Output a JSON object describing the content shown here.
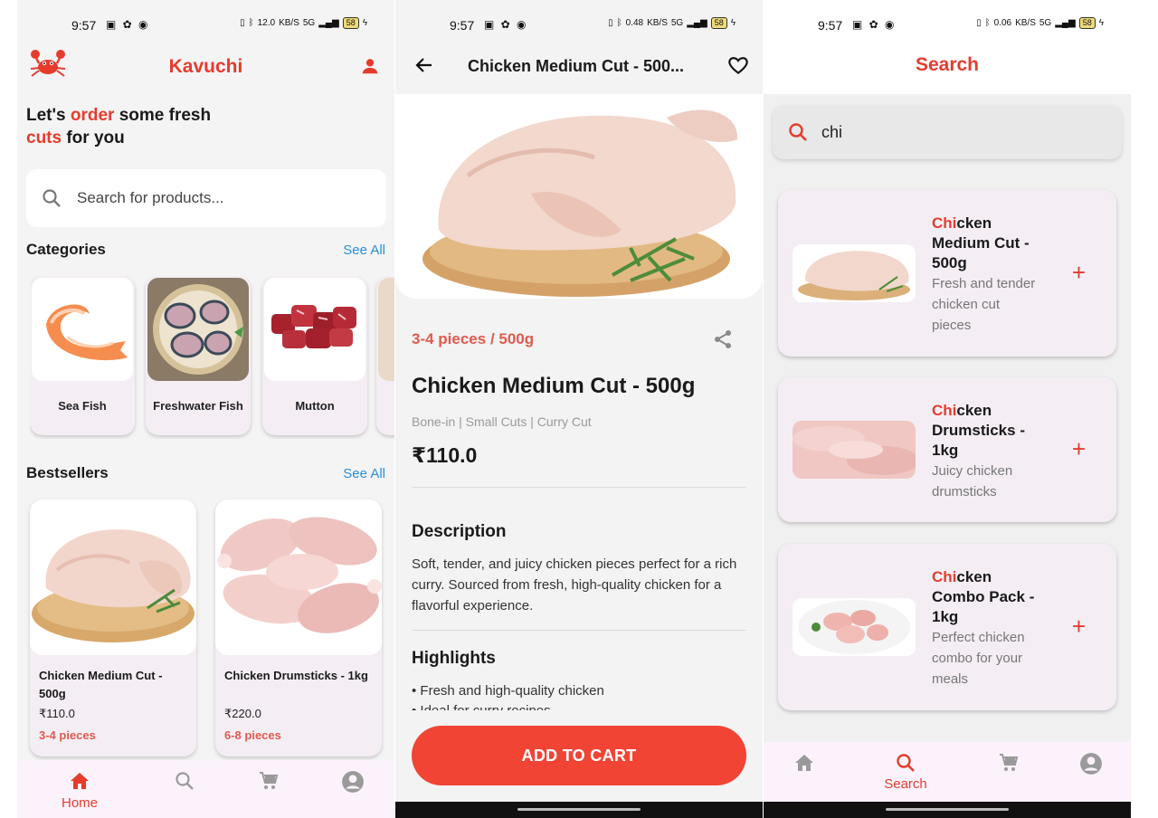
{
  "status": {
    "time": "9:57",
    "speeds": [
      "12.0",
      "0.48",
      "0.06"
    ],
    "speed_unit": "KB/S",
    "network": "5G",
    "battery": "58"
  },
  "home": {
    "brand": "Kavuchi",
    "greeting": {
      "p1": "Let's ",
      "p2": "order",
      "p3": " some fresh ",
      "p4": "cuts",
      "p5": " for you"
    },
    "search_placeholder": "Search for products...",
    "categories_title": "Categories",
    "see_all": "See All",
    "categories": [
      {
        "label": "Sea Fish"
      },
      {
        "label": "Freshwater Fish"
      },
      {
        "label": "Mutton"
      }
    ],
    "bestsellers_title": "Bestsellers",
    "products": [
      {
        "name": "Chicken Medium Cut - 500g",
        "price": "₹110.0",
        "pieces": "3-4 pieces"
      },
      {
        "name": "Chicken Drumsticks - 1kg",
        "price": "₹220.0",
        "pieces": "6-8 pieces"
      }
    ],
    "nav": {
      "home": "Home"
    }
  },
  "detail": {
    "title": "Chicken Medium Cut - 500...",
    "pieces_weight": "3-4 pieces / 500g",
    "name": "Chicken Medium Cut - 500g",
    "tags": "Bone-in | Small Cuts | Curry Cut",
    "price": "₹110.0",
    "description_title": "Description",
    "description": "Soft, tender, and juicy chicken pieces perfect for a rich curry. Sourced from fresh, high-quality chicken for a flavorful experience.",
    "highlights_title": "Highlights",
    "highlights": [
      "• Fresh and high-quality chicken",
      "• Ideal for curry recipes"
    ],
    "add_to_cart": "ADD TO CART"
  },
  "search": {
    "title": "Search",
    "query": "chi",
    "results": [
      {
        "match": "Chi",
        "rest": "cken Medium Cut - 500g",
        "desc": "Fresh and tender chicken cut pieces"
      },
      {
        "match": "Chi",
        "rest": "cken Drumsticks - 1kg",
        "desc": "Juicy chicken drumsticks"
      },
      {
        "match": "Chi",
        "rest": "cken Combo Pack - 1kg",
        "desc": "Perfect chicken combo for your meals"
      }
    ],
    "nav": {
      "search": "Search"
    }
  },
  "colors": {
    "accent": "#e53c2e",
    "cta": "#f14434",
    "link": "#2a8fd6"
  }
}
